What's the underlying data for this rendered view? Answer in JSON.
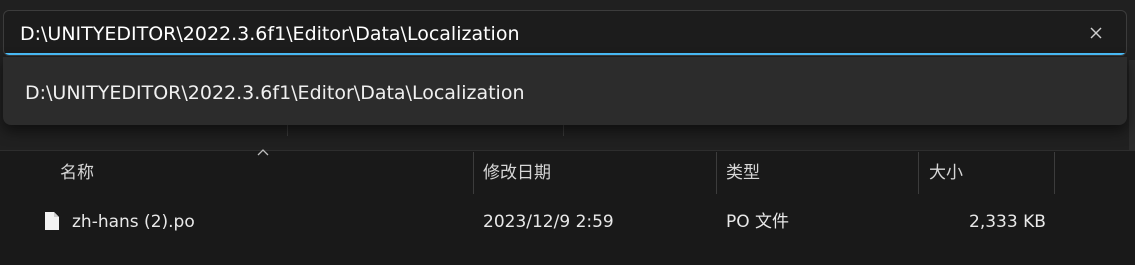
{
  "address_bar": {
    "value": "D:\\UNITYEDITOR\\2022.3.6f1\\Editor\\Data\\Localization",
    "clear_icon": "close-icon"
  },
  "suggestions": [
    {
      "label": "D:\\UNITYEDITOR\\2022.3.6f1\\Editor\\Data\\Localization"
    }
  ],
  "columns": {
    "name": "名称",
    "modified": "修改日期",
    "type": "类型",
    "size": "大小",
    "sorted_by": "name"
  },
  "files": [
    {
      "name": "zh-hans (2).po",
      "modified": "2023/12/9 2:59",
      "type": "PO 文件",
      "size": "2,333 KB",
      "icon": "document-icon"
    }
  ],
  "colors": {
    "accent": "#4cc2ff",
    "background": "#191919",
    "dropdown": "#2c2c2c"
  }
}
